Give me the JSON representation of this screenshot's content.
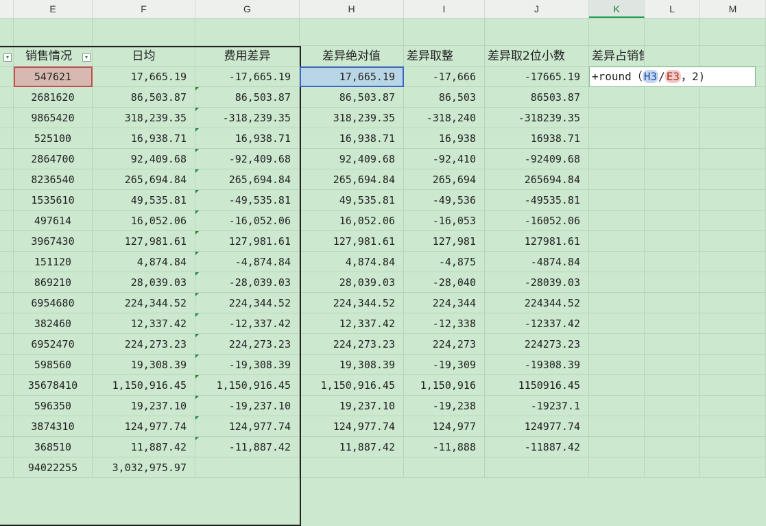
{
  "columns": [
    "E",
    "F",
    "G",
    "H",
    "I",
    "J",
    "K",
    "L",
    "M"
  ],
  "selected_column": "K",
  "headers": {
    "E": "销售情况",
    "F": "日均",
    "G": "费用差异",
    "H": "差异绝对值",
    "I": "差异取整",
    "J": "差异取2位小数",
    "K": "差异占销售比列"
  },
  "formula": {
    "prefix": "+round（",
    "ref1": "H3",
    "op": "/",
    "ref2": "E3",
    "suffix": "，2)"
  },
  "rows": [
    {
      "E": "547621",
      "F": "17,665.19",
      "G": "-17,665.19",
      "H": "17,665.19",
      "I": "-17,666",
      "J": "-17665.19"
    },
    {
      "E": "2681620",
      "F": "86,503.87",
      "G": "86,503.87",
      "H": "86,503.87",
      "I": "86,503",
      "J": "86503.87"
    },
    {
      "E": "9865420",
      "F": "318,239.35",
      "G": "-318,239.35",
      "H": "318,239.35",
      "I": "-318,240",
      "J": "-318239.35"
    },
    {
      "E": "525100",
      "F": "16,938.71",
      "G": "16,938.71",
      "H": "16,938.71",
      "I": "16,938",
      "J": "16938.71"
    },
    {
      "E": "2864700",
      "F": "92,409.68",
      "G": "-92,409.68",
      "H": "92,409.68",
      "I": "-92,410",
      "J": "-92409.68"
    },
    {
      "E": "8236540",
      "F": "265,694.84",
      "G": "265,694.84",
      "H": "265,694.84",
      "I": "265,694",
      "J": "265694.84"
    },
    {
      "E": "1535610",
      "F": "49,535.81",
      "G": "-49,535.81",
      "H": "49,535.81",
      "I": "-49,536",
      "J": "-49535.81"
    },
    {
      "E": "497614",
      "F": "16,052.06",
      "G": "-16,052.06",
      "H": "16,052.06",
      "I": "-16,053",
      "J": "-16052.06"
    },
    {
      "E": "3967430",
      "F": "127,981.61",
      "G": "127,981.61",
      "H": "127,981.61",
      "I": "127,981",
      "J": "127981.61"
    },
    {
      "E": "151120",
      "F": "4,874.84",
      "G": "-4,874.84",
      "H": "4,874.84",
      "I": "-4,875",
      "J": "-4874.84"
    },
    {
      "E": "869210",
      "F": "28,039.03",
      "G": "-28,039.03",
      "H": "28,039.03",
      "I": "-28,040",
      "J": "-28039.03"
    },
    {
      "E": "6954680",
      "F": "224,344.52",
      "G": "224,344.52",
      "H": "224,344.52",
      "I": "224,344",
      "J": "224344.52"
    },
    {
      "E": "382460",
      "F": "12,337.42",
      "G": "-12,337.42",
      "H": "12,337.42",
      "I": "-12,338",
      "J": "-12337.42"
    },
    {
      "E": "6952470",
      "F": "224,273.23",
      "G": "224,273.23",
      "H": "224,273.23",
      "I": "224,273",
      "J": "224273.23"
    },
    {
      "E": "598560",
      "F": "19,308.39",
      "G": "-19,308.39",
      "H": "19,308.39",
      "I": "-19,309",
      "J": "-19308.39"
    },
    {
      "E": "35678410",
      "F": "1,150,916.45",
      "G": "1,150,916.45",
      "H": "1,150,916.45",
      "I": "1,150,916",
      "J": "1150916.45"
    },
    {
      "E": "596350",
      "F": "19,237.10",
      "G": "-19,237.10",
      "H": "19,237.10",
      "I": "-19,238",
      "J": "-19237.1"
    },
    {
      "E": "3874310",
      "F": "124,977.74",
      "G": "124,977.74",
      "H": "124,977.74",
      "I": "124,977",
      "J": "124977.74"
    },
    {
      "E": "368510",
      "F": "11,887.42",
      "G": "-11,887.42",
      "H": "11,887.42",
      "I": "-11,888",
      "J": "-11887.42"
    }
  ],
  "total_row": {
    "E": "94022255",
    "F": "3,032,975.97"
  }
}
